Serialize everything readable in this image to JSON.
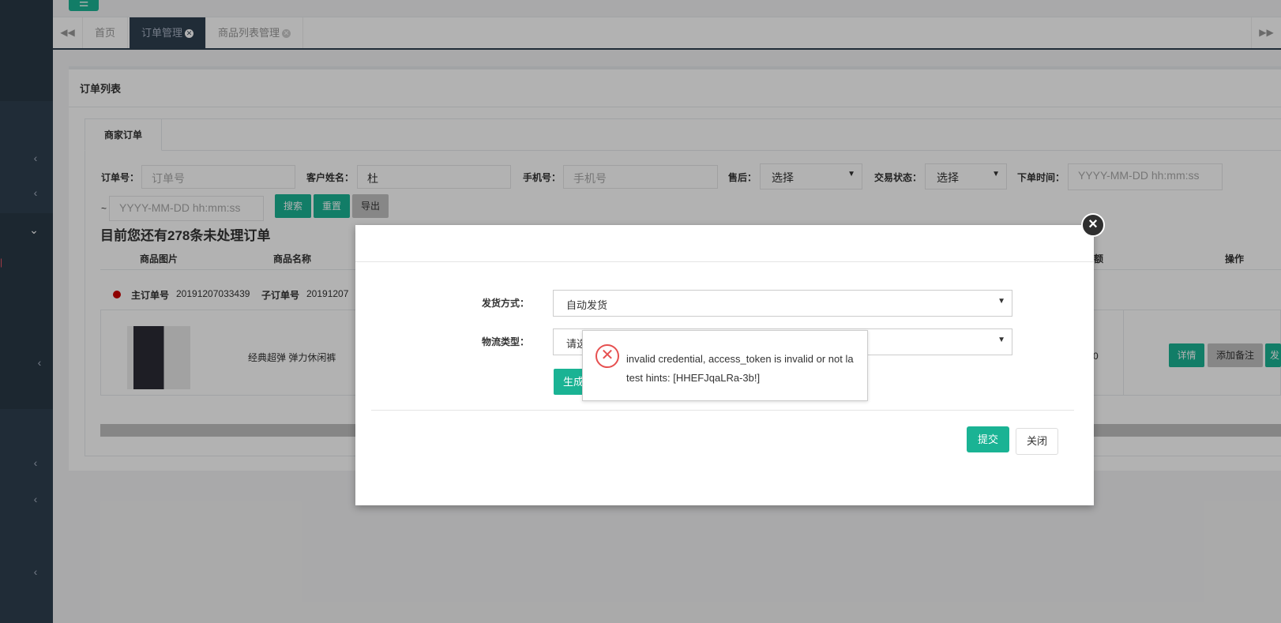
{
  "topbar": {
    "menu_icon": "menu-icon"
  },
  "tabs": [
    {
      "label": "首页"
    },
    {
      "label": "订单管理"
    },
    {
      "label": "商品列表管理"
    }
  ],
  "page": {
    "title": "订单列表",
    "panel_tab": "商家订单",
    "filters": {
      "order_no_label": "订单号：",
      "order_no_placeholder": "订单号",
      "customer_label": "客户姓名：",
      "customer_value": "杜",
      "phone_label": "手机号：",
      "phone_placeholder": "手机号",
      "after_sale_label": "售后：",
      "after_sale_value": "选择",
      "trade_status_label": "交易状态：",
      "trade_status_value": "选择",
      "order_time_label": "下单时间：",
      "time_start_placeholder": "YYYY-MM-DD hh:mm:ss",
      "tilde": "~",
      "time_end_placeholder": "YYYY-MM-DD hh:mm:ss"
    },
    "buttons": {
      "search": "搜索",
      "reset": "重置",
      "export": "导出"
    },
    "notice": "目前您还有278条未处理订单",
    "table_headers": [
      "商品图片",
      "商品名称",
      "额",
      "操作"
    ],
    "order": {
      "main_label": "主订单号",
      "main_no": "20191207033439",
      "sub_label": "子订单号",
      "sub_no": "20191207",
      "product_name": "经典超弹 弹力休闲裤",
      "amount_fragment": "0",
      "actions": {
        "detail": "详情",
        "add_note": "添加备注",
        "ship": "发"
      }
    }
  },
  "modal": {
    "ship_method_label": "发货方式：",
    "ship_method_value": "自动发货",
    "logistics_label": "物流类型：",
    "logistics_value": "请选",
    "generate_btn": "生成",
    "submit": "提交",
    "close": "关闭"
  },
  "toast": {
    "message": "invalid credential, access_token is invalid or not latest hints: [HHEFJqaLRa-3b!]"
  },
  "colors": {
    "sidebar": "#2f4050",
    "accent": "#1ab394",
    "error": "#e65050"
  }
}
